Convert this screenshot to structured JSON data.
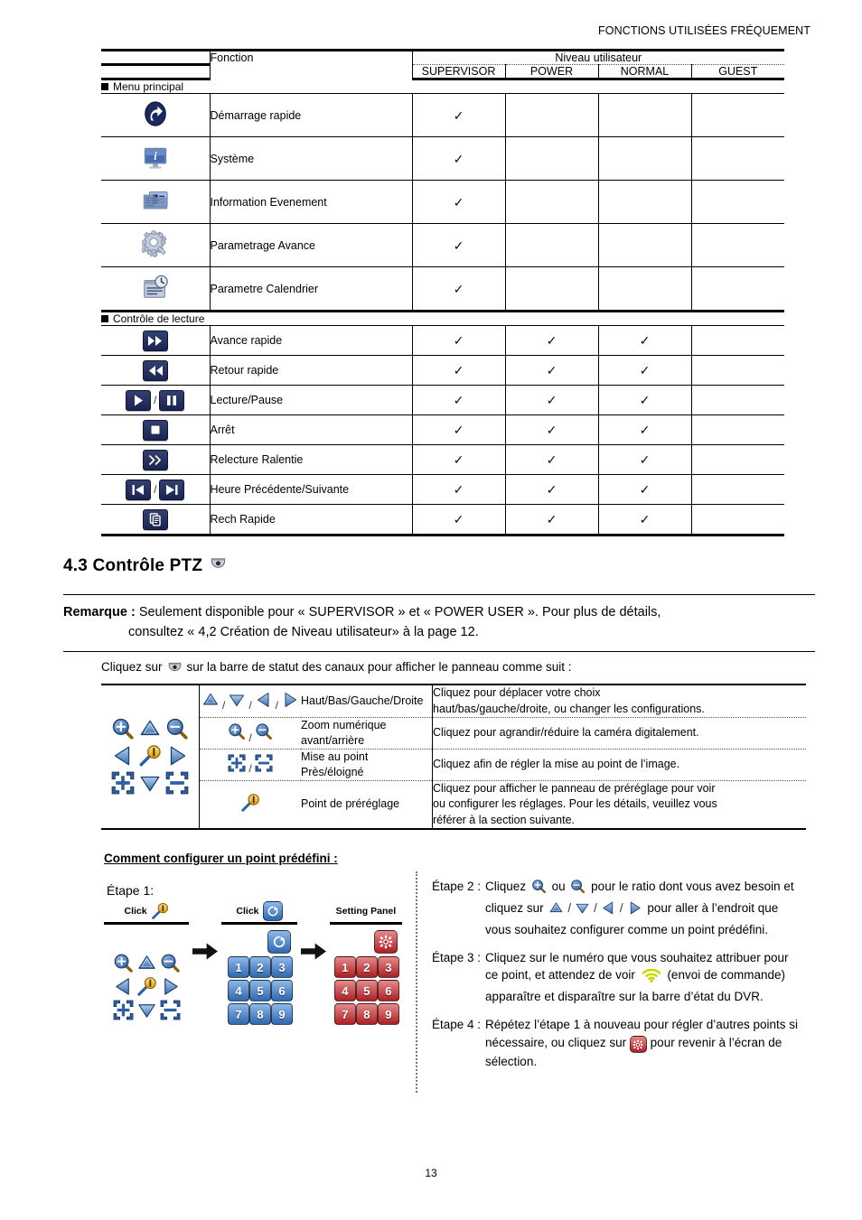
{
  "header": {
    "running_title": "FONCTIONS UTILISÉES FRÉQUEMENT"
  },
  "page": {
    "number": "13"
  },
  "permissions_table": {
    "columns": {
      "function": "Fonction",
      "user_level": "Niveau utilisateur",
      "levels": [
        "SUPERVISOR",
        "POWER",
        "NORMAL",
        "GUEST"
      ]
    },
    "groups": [
      {
        "label": "Menu principal",
        "rows": [
          {
            "icon": "quick-start-icon",
            "label": "Démarrage rapide",
            "checks": [
              true,
              false,
              false,
              false
            ]
          },
          {
            "icon": "system-monitor-icon",
            "label": "Système",
            "checks": [
              true,
              false,
              false,
              false
            ]
          },
          {
            "icon": "event-information-icon",
            "label": "Information Evenement",
            "checks": [
              true,
              false,
              false,
              false
            ]
          },
          {
            "icon": "advanced-config-gear-icon",
            "label": "Parametrage Avance",
            "checks": [
              true,
              false,
              false,
              false
            ]
          },
          {
            "icon": "schedule-calendar-icon",
            "label": "Parametre Calendrier",
            "checks": [
              true,
              false,
              false,
              false
            ]
          }
        ]
      },
      {
        "label": "Contrôle de lecture",
        "rows": [
          {
            "icon": "fast-forward-icon",
            "label": "Avance rapide",
            "checks": [
              true,
              true,
              true,
              false
            ]
          },
          {
            "icon": "rewind-icon",
            "label": "Retour rapide",
            "checks": [
              true,
              true,
              true,
              false
            ]
          },
          {
            "icon": "play-pause-icon",
            "label": "Lecture/Pause",
            "checks": [
              true,
              true,
              true,
              false
            ]
          },
          {
            "icon": "stop-icon",
            "label": "Arrêt",
            "checks": [
              true,
              true,
              true,
              false
            ]
          },
          {
            "icon": "slow-playback-icon",
            "label": "Relecture Ralentie",
            "checks": [
              true,
              true,
              true,
              false
            ]
          },
          {
            "icon": "previous-next-hour-icon",
            "label": "Heure Précédente/Suivante",
            "checks": [
              true,
              true,
              true,
              false
            ]
          },
          {
            "icon": "quick-search-icon",
            "label": "Rech Rapide",
            "checks": [
              true,
              true,
              true,
              false
            ]
          }
        ]
      }
    ],
    "check_glyph": "✓"
  },
  "section": {
    "number_title": "4.3 Contrôle PTZ",
    "icon": "ptz-dome-camera-icon",
    "note_label": "Remarque :",
    "note_line1": "Seulement disponible pour « SUPERVISOR » et « POWER USER ». Pour plus de détails,",
    "note_line2": "consultez « 4,2 Création de Niveau utilisateur» à la page 12.",
    "click_text_before": "Cliquez sur",
    "click_text_after": "sur la barre de statut des canaux pour afficher le panneau comme suit :"
  },
  "ptz_panel": {
    "cluster_icons": [
      "zoom-in-icon",
      "up-arrow-icon",
      "zoom-out-icon",
      "left-arrow-icon",
      "preset-key-icon",
      "right-arrow-icon",
      "focus-near-icon",
      "down-arrow-icon",
      "focus-far-icon"
    ],
    "rows": [
      {
        "icons": [
          "up-arrow-icon",
          "down-arrow-icon",
          "left-arrow-icon",
          "right-arrow-icon"
        ],
        "name": "Haut/Bas/Gauche/Droite",
        "desc_line1": "Cliquez pour déplacer votre choix",
        "desc_line2": "haut/bas/gauche/droite, ou changer les configurations."
      },
      {
        "icons": [
          "zoom-in-icon",
          "zoom-out-icon"
        ],
        "name_line1": "Zoom numérique",
        "name_line2": "avant/arrière",
        "desc_line1": "Cliquez pour agrandir/réduire la caméra digitalement.",
        "desc_line2": ""
      },
      {
        "icons": [
          "focus-near-icon",
          "focus-far-icon"
        ],
        "name_line1": "Mise au point",
        "name_line2": "Près/éloigné",
        "desc_line1": "Cliquez afin de régler la mise au point de l’image.",
        "desc_line2": ""
      },
      {
        "icons": [
          "preset-key-icon"
        ],
        "name": "Point de préréglage",
        "desc_line1": "Cliquez pour afficher le panneau de préréglage pour voir",
        "desc_line2": "ou configurer les réglages. Pour les détails, veuillez vous",
        "desc_line3": "référer à la section suivante."
      }
    ]
  },
  "preset": {
    "title": "Comment configurer un point prédéfini :",
    "etape1_label": "Étape 1:",
    "flow": {
      "panel1_caption": "Click",
      "panel1_icon": "preset-key-icon",
      "panel2_caption": "Click",
      "panel2_icon": "go-preset-icon",
      "panel3_caption": "Setting Panel",
      "keypad_digits": [
        "1",
        "2",
        "3",
        "4",
        "5",
        "6",
        "7",
        "8",
        "9"
      ],
      "panel2_top_icon": "go-preset-icon",
      "panel3_top_icon": "settings-gear-red-icon",
      "arrow_icon": "right-arrow-black-icon"
    },
    "steps": [
      {
        "key": "Étape 2 :",
        "parts": [
          "Cliquez ",
          "[zoom-in-icon]",
          " ou ",
          "[zoom-out-icon]",
          " pour le ratio dont vous avez besoin et cliquez sur ",
          "[up-arrow-icon]",
          " / ",
          "[down-arrow-icon]",
          " / ",
          "[left-arrow-icon]",
          " / ",
          "[right-arrow-icon]",
          " pour aller à l’endroit que vous souhaitez configurer comme un point prédéfini."
        ],
        "text": "Cliquez ⊕ ou ⊖ pour le ratio dont vous avez besoin et cliquez sur ▲ / ▼ / ◀ / ▶ pour aller à l’endroit que vous souhaitez configurer comme un point prédéfini."
      },
      {
        "key": "Étape 3 :",
        "text": "Cliquez sur le numéro que vous souhaitez attribuer pour ce point, et attendez de voir (wifi-signal-icon) (envoi de commande) apparaître et disparaître sur la barre d’état du DVR."
      },
      {
        "key": "Étape 4 :",
        "text": "Répétez l’étape 1 à nouveau pour régler d’autres points si nécessaire, ou cliquez sur (settings-gear-red-icon) pour revenir à l’écran de sélection."
      }
    ],
    "step2_t1": "Cliquez",
    "step2_t2": "ou",
    "step2_t3": "pour le ratio dont vous avez",
    "step2_t4": "besoin et cliquez sur",
    "step2_t5": "pour",
    "step2_t6": "aller à l’endroit que vous souhaitez configurer",
    "step2_t7": "comme un point prédéfini.",
    "step3_t1": "Cliquez sur le numéro que vous souhaitez",
    "step3_t2": "attribuer pour ce point, et attendez de voir",
    "step3_t3": "(envoi de commande) apparaître et disparaître",
    "step3_t4": "sur la barre d’état du DVR.",
    "step4_t1": "Répétez l’étape 1 à nouveau pour régler d’autres",
    "step4_t2": "points si nécessaire, ou cliquez sur",
    "step4_t3": "pour",
    "step4_t4": "revenir à l’écran de sélection."
  },
  "colors": {
    "nav_button": "#1b2450",
    "blue_key": "#2f68ad",
    "red_key": "#ad1f26",
    "arrow_blue": "#4a7fc1",
    "gold": "#e8b022"
  }
}
